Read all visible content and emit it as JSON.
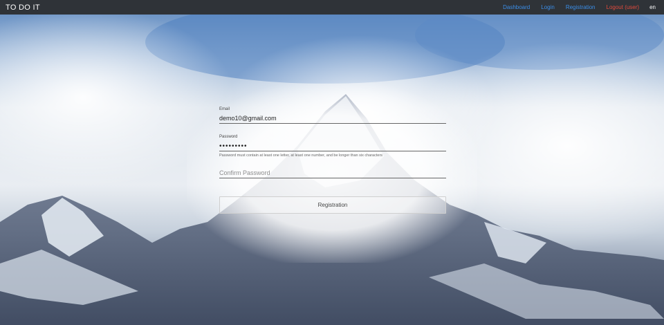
{
  "app": {
    "title": "TO DO IT"
  },
  "nav": {
    "dashboard": "Dashboard",
    "login": "Login",
    "registration": "Registration",
    "logout": "Logout (user)",
    "language": "en"
  },
  "form": {
    "email_label": "Email",
    "email_value": "demo10@gmail.com",
    "password_label": "Password",
    "password_value": "•••••••••",
    "password_hint": "Password must contain at least one letter, at least one number, and be longer than six characters",
    "confirm_placeholder": "Confirm Password",
    "submit_label": "Registration"
  },
  "colors": {
    "navbar": "#2f3338",
    "link": "#3b8ee8",
    "logout": "#e04a3c"
  }
}
